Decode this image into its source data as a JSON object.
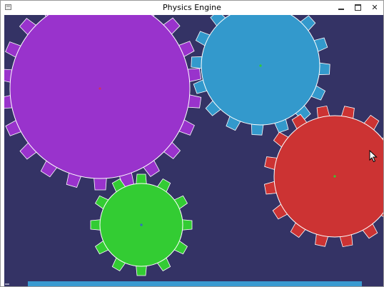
{
  "window": {
    "title": "Physics Engine",
    "app_icon": "window-app-icon",
    "buttons": {
      "minimize_icon": "minimize-icon",
      "maximize_icon": "maximize-icon",
      "close_glyph": "✕"
    }
  },
  "scene": {
    "background_color": "#343365",
    "gears": [
      {
        "name": "purple",
        "fill": "#9933cc",
        "teeth": 22,
        "hub_color": "#cc3366"
      },
      {
        "name": "blue",
        "fill": "#3399cc",
        "teeth": 16,
        "hub_color": "#33cc33"
      },
      {
        "name": "red",
        "fill": "#cc3333",
        "teeth": 16,
        "hub_color": "#33cc33"
      },
      {
        "name": "green",
        "fill": "#33cc33",
        "teeth": 12,
        "hub_color": "#3366cc"
      }
    ],
    "platform_color": "#3a9ad0"
  },
  "cursor_icon": "mouse-pointer-icon"
}
